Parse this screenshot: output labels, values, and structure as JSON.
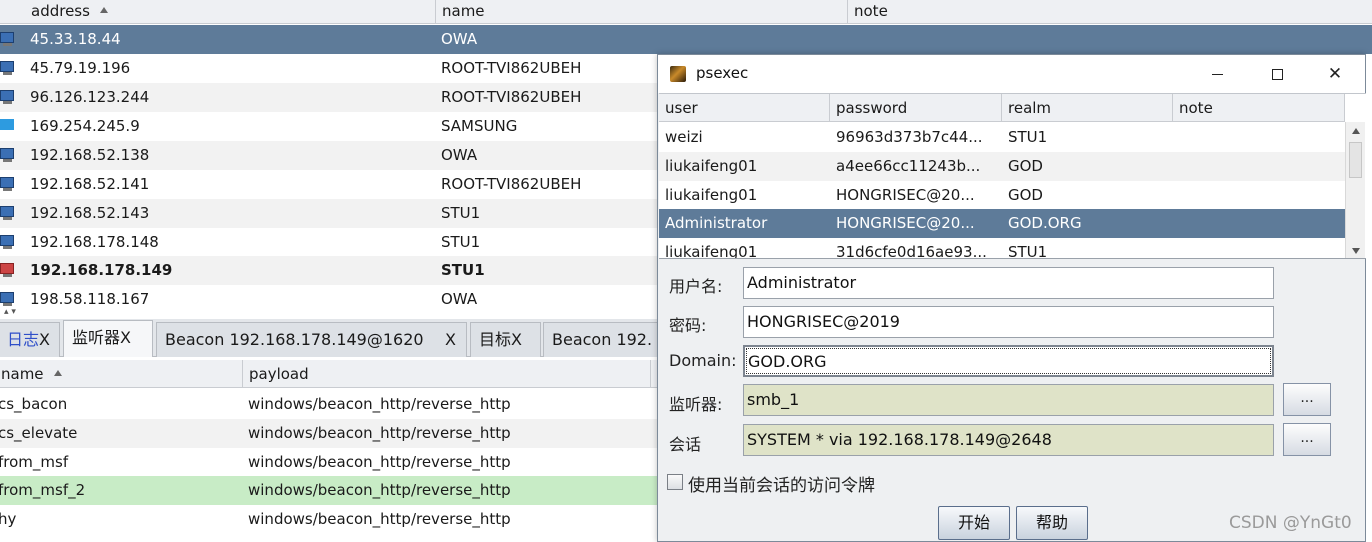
{
  "targets": {
    "columns": {
      "address": "address",
      "name": "name",
      "note": "note"
    },
    "rows": [
      {
        "address": "45.33.18.44",
        "name": "OWA",
        "icon": "windows-pc-icon"
      },
      {
        "address": "45.79.19.196",
        "name": "ROOT-TVI862UBEH",
        "icon": "windows-pc-icon"
      },
      {
        "address": "96.126.123.244",
        "name": "ROOT-TVI862UBEH",
        "icon": "windows-pc-icon"
      },
      {
        "address": "169.254.245.9",
        "name": "SAMSUNG",
        "icon": "windows10-icon"
      },
      {
        "address": "192.168.52.138",
        "name": "OWA",
        "icon": "windows-pc-icon"
      },
      {
        "address": "192.168.52.141",
        "name": "ROOT-TVI862UBEH",
        "icon": "windows-pc-icon"
      },
      {
        "address": "192.168.52.143",
        "name": "STU1",
        "icon": "windows-pc-icon"
      },
      {
        "address": "192.168.178.148",
        "name": "STU1",
        "icon": "windows-pc-icon"
      },
      {
        "address": "192.168.178.149",
        "name": "STU1",
        "icon": "compromised-pc-icon"
      },
      {
        "address": "198.58.118.167",
        "name": "OWA",
        "icon": "windows-pc-icon"
      }
    ]
  },
  "tabs": [
    {
      "label": "日志",
      "close": "X"
    },
    {
      "label": "监听器",
      "close": "X"
    },
    {
      "label": "Beacon 192.168.178.149@1620",
      "close": "X"
    },
    {
      "label": "目标",
      "close": "X"
    },
    {
      "label": "Beacon 192."
    }
  ],
  "listeners": {
    "columns": {
      "name": "name",
      "payload": "payload"
    },
    "rows": [
      {
        "name": "cs_bacon",
        "payload": "windows/beacon_http/reverse_http"
      },
      {
        "name": "cs_elevate",
        "payload": "windows/beacon_http/reverse_http"
      },
      {
        "name": "from_msf",
        "payload": "windows/beacon_http/reverse_http"
      },
      {
        "name": "from_msf_2",
        "payload": "windows/beacon_http/reverse_http"
      },
      {
        "name": "hy",
        "payload": "windows/beacon_http/reverse_http"
      }
    ]
  },
  "dialog": {
    "title": "psexec",
    "close_glyph": "✕",
    "cred_columns": {
      "user": "user",
      "password": "password",
      "realm": "realm",
      "note": "note"
    },
    "credentials": [
      {
        "user": "weizi",
        "password": "96963d373b7c44...",
        "realm": "STU1"
      },
      {
        "user": "liukaifeng01",
        "password": "a4ee66cc11243b...",
        "realm": "GOD"
      },
      {
        "user": "liukaifeng01",
        "password": "HONGRISEC@20...",
        "realm": "GOD"
      },
      {
        "user": "Administrator",
        "password": "HONGRISEC@20...",
        "realm": "GOD.ORG"
      },
      {
        "user": "liukaifeng01",
        "password": "31d6cfe0d16ae93...",
        "realm": "STU1"
      }
    ],
    "form": {
      "username_label": "用户名:",
      "username_value": "Administrator",
      "password_label": "密码:",
      "password_value": "HONGRISEC@2019",
      "domain_label": "Domain:",
      "domain_value": "GOD.ORG",
      "listener_label": "监听器:",
      "listener_value": "smb_1",
      "session_label": "会话",
      "session_value": "SYSTEM * via  192.168.178.149@2648",
      "browse_label": "...",
      "token_checkbox_label": "使用当前会话的访问令牌",
      "token_checked": false
    },
    "buttons": {
      "start": "开始",
      "help": "帮助"
    }
  },
  "watermark": "CSDN @YnGt0",
  "colors": {
    "selection": "#5e7b99",
    "highlight_row": "#c8ecc6",
    "readonly_field": "#dfe3c8"
  }
}
